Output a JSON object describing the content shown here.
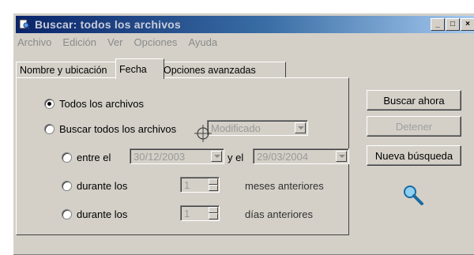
{
  "window": {
    "title": "Buscar: todos los archivos",
    "controls": [
      "_",
      "□",
      "×"
    ]
  },
  "menu": [
    "Archivo",
    "Edición",
    "Ver",
    "Opciones",
    "Ayuda"
  ],
  "tabs": [
    {
      "label": "Nombre y ubicación",
      "active": false
    },
    {
      "label": "Fecha",
      "active": true
    },
    {
      "label": "Opciones avanzadas",
      "active": false
    }
  ],
  "fecha": {
    "all_files_label": "Todos los archivos",
    "find_all_label": "Buscar todos los archivos",
    "find_mode_value": "Modificado",
    "between_label": "entre el",
    "date_from": "30/12/2003",
    "and_label": "y el",
    "date_to": "29/03/2004",
    "during_months_label": "durante los",
    "months_value": "1",
    "months_suffix": "meses anteriores",
    "during_days_label": "durante los",
    "days_value": "1",
    "days_suffix": "días anteriores"
  },
  "buttons": {
    "search_now": "Buscar ahora",
    "stop": "Detener",
    "new_search": "Nueva búsqueda"
  },
  "icons": {
    "window_icon": "search-window-icon",
    "magnifier": "magnifier-icon",
    "cursor": "crosshair-cursor-icon"
  },
  "colors": {
    "titlebar_start": "#0a246a",
    "titlebar_end": "#a6caf0",
    "face": "#d4d0c8"
  }
}
